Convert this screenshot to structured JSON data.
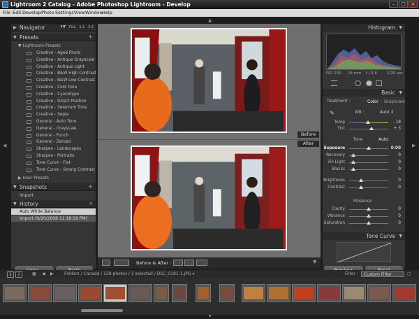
{
  "window": {
    "title": "Lightroom 2 Catalog - Adobe Photoshop Lightroom - Develop",
    "min": "–",
    "max": "□",
    "close": "×"
  },
  "menu": [
    "File",
    "Edit",
    "Develop",
    "Photo",
    "Settings",
    "View",
    "Window",
    "Help"
  ],
  "left": {
    "navigator": "Navigator",
    "nav_opts": [
      "FIT",
      "FILL",
      "1:1",
      "3:1"
    ],
    "presets": "Presets",
    "lightroom_presets": "Lightroom Presets",
    "preset_items": [
      "Creative - Aged Photo",
      "Creative - Antique Grayscale",
      "Creative - Antique Light",
      "Creative - B&W High Contrast",
      "Creative - B&W Low Contrast",
      "Creative - Cold Tone",
      "Creative - Cyanotype",
      "Creative - Direct Positive",
      "Creative - Selenium Tone",
      "Creative - Sepia",
      "General - Auto Tone",
      "General - Grayscale",
      "General - Punch",
      "General - Zeroed",
      "Sharpen - Landscapes",
      "Sharpen - Portraits",
      "Tone Curve - Flat",
      "Tone Curve - Strong Contrast"
    ],
    "user_presets": "User Presets",
    "snapshots": "Snapshots",
    "snapshot_items": [
      "Import"
    ],
    "history": "History",
    "history_items": [
      "Auto White Balance",
      "Import (9/20/2008 11:18:19 PM)"
    ],
    "copy": "Copy...",
    "paste": "Paste"
  },
  "center": {
    "before": "Before",
    "after": "After",
    "toolbar_label": "Before & After :"
  },
  "right": {
    "histogram": "Histogram",
    "exif": [
      "ISO 230",
      "18 mm",
      "f / 5.6",
      "1/20 sec"
    ],
    "basic": "Basic",
    "treatment": "Treatment :",
    "color": "Color",
    "grayscale": "Grayscale",
    "wb_label": "WB :",
    "wb_value": "Auto ⇕",
    "temp": {
      "label": "Temp",
      "value": "- 19"
    },
    "tint": {
      "label": "Tint",
      "value": "+ 3"
    },
    "tone": "Tone",
    "auto": "Auto",
    "exposure": {
      "label": "Exposure",
      "value": "0.00"
    },
    "recovery": {
      "label": "Recovery",
      "value": "0"
    },
    "fill_light": {
      "label": "Fill Light",
      "value": "0"
    },
    "blacks": {
      "label": "Blacks",
      "value": "0"
    },
    "brightness": {
      "label": "Brightness",
      "value": "0"
    },
    "contrast": {
      "label": "Contrast",
      "value": "0"
    },
    "presence": "Presence",
    "clarity": {
      "label": "Clarity",
      "value": "0"
    },
    "vibrance": {
      "label": "Vibrance",
      "value": "0"
    },
    "saturation": {
      "label": "Saturation",
      "value": "0"
    },
    "tone_curve": "Tone Curve",
    "previous": "Previous",
    "reset": "Reset"
  },
  "filmbar": {
    "pages": [
      "1",
      "2"
    ],
    "path": "Folders / Canada / 158 photos / 1 selected / DSC_0181-1.JPG ▾",
    "filter_label": "Filter :",
    "filter_value": "Custom Filter"
  },
  "colors": {
    "selected_history": "#cfcfcf",
    "panel": "#353535",
    "center_bg": "#6f6f6f"
  }
}
